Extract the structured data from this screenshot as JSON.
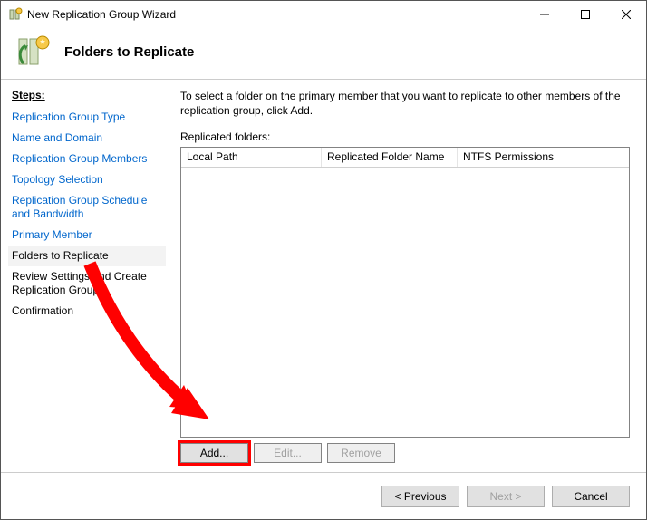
{
  "window": {
    "title": "New Replication Group Wizard"
  },
  "header": {
    "heading": "Folders to Replicate"
  },
  "sidebar": {
    "label": "Steps:",
    "items": [
      {
        "label": "Replication Group Type",
        "state": "link"
      },
      {
        "label": "Name and Domain",
        "state": "link"
      },
      {
        "label": "Replication Group Members",
        "state": "link"
      },
      {
        "label": "Topology Selection",
        "state": "link"
      },
      {
        "label": "Replication Group Schedule and Bandwidth",
        "state": "link"
      },
      {
        "label": "Primary Member",
        "state": "link"
      },
      {
        "label": "Folders to Replicate",
        "state": "current"
      },
      {
        "label": "Review Settings and Create Replication Group",
        "state": "future"
      },
      {
        "label": "Confirmation",
        "state": "future"
      }
    ]
  },
  "main": {
    "instruction": "To select a folder on the primary member that you want to replicate to other members of the replication group, click Add.",
    "grid_label": "Replicated folders:",
    "columns": {
      "c1": "Local Path",
      "c2": "Replicated Folder Name",
      "c3": "NTFS Permissions"
    },
    "rows": []
  },
  "buttons": {
    "add": "Add...",
    "edit": "Edit...",
    "remove": "Remove"
  },
  "footer": {
    "previous": "< Previous",
    "next": "Next >",
    "cancel": "Cancel"
  }
}
